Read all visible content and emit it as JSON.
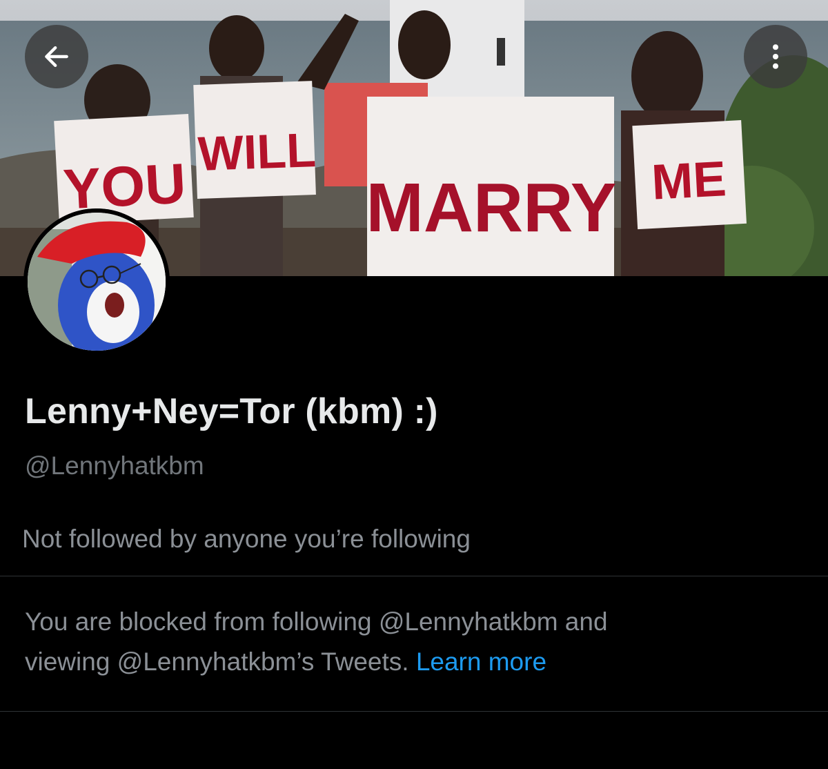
{
  "profile": {
    "display_name": "Lenny+Ney=Tor (kbm) :)",
    "handle": "@Lennyhatkbm",
    "followers_context": "Not followed by anyone you’re following"
  },
  "banner": {
    "signs": [
      "YOU",
      "WILL",
      "MARRY",
      "ME"
    ]
  },
  "blocked": {
    "text_line_1": "You are blocked from following @Lennyhatkbm and",
    "text_line_2": "viewing @Lennyhatkbm’s Tweets.",
    "link_label": "Learn more"
  },
  "icons": {
    "back": "arrow-left-icon",
    "more": "more-vertical-icon"
  },
  "colors": {
    "background": "#000000",
    "primary_text": "#e7e9ea",
    "secondary_text": "#71767b",
    "link": "#1d9bf0",
    "divider": "#2f3336",
    "sign_letters": "#b3122a"
  }
}
